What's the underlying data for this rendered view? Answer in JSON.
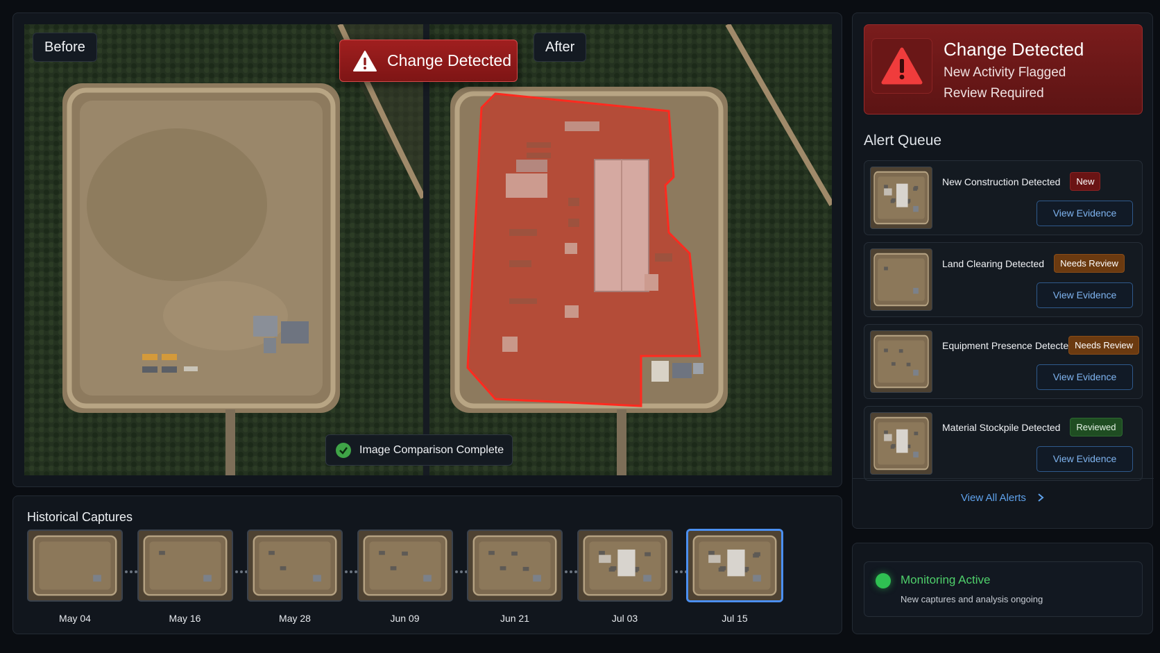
{
  "compare": {
    "before_label": "Before",
    "after_label": "After",
    "banner": "Change Detected",
    "status": "Image Comparison Complete"
  },
  "history": {
    "title": "Historical Captures",
    "captures": [
      {
        "date": "May 04",
        "active": false
      },
      {
        "date": "May 16",
        "active": false
      },
      {
        "date": "May 28",
        "active": false
      },
      {
        "date": "Jun 09",
        "active": false
      },
      {
        "date": "Jun 21",
        "active": false
      },
      {
        "date": "Jul 03",
        "active": false
      },
      {
        "date": "Jul 15",
        "active": true
      }
    ]
  },
  "alert": {
    "title": "Change Detected",
    "line1": "New Activity Flagged",
    "line2": "Review Required",
    "icon": "warning-triangle-icon"
  },
  "queue": {
    "title": "Alert Queue",
    "items": [
      {
        "title": "New Construction Detected",
        "badge": "New",
        "badge_type": "new",
        "button": "View Evidence"
      },
      {
        "title": "Land Clearing Detected",
        "badge": "Needs Review",
        "badge_type": "review",
        "button": "View Evidence"
      },
      {
        "title": "Equipment Presence Detected",
        "badge": "Needs Review",
        "badge_type": "review",
        "button": "View Evidence"
      },
      {
        "title": "Material Stockpile Detected",
        "badge": "Reviewed",
        "badge_type": "reviewed",
        "button": "View Evidence"
      }
    ],
    "view_all": "View All Alerts"
  },
  "monitor": {
    "title": "Monitoring Active",
    "subtitle": "New captures and analysis ongoing"
  },
  "colors": {
    "alert_red": "#a01f1f",
    "accent_blue": "#4b8ff0",
    "active_green": "#2fc052"
  }
}
